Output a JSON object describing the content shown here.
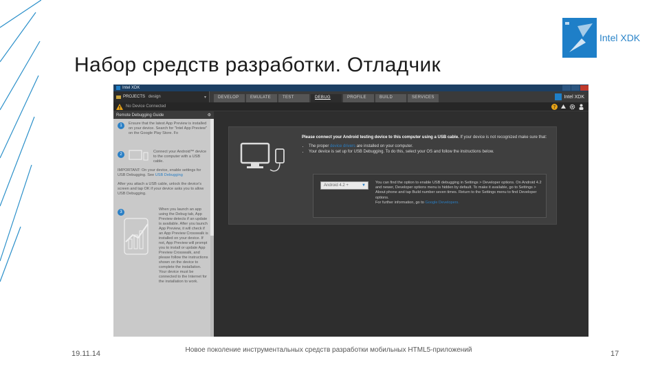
{
  "slide": {
    "title": "Набор средств разработки. Отладчик",
    "logo_text": "Intel XDK",
    "footer_date": "19.11.14",
    "footer_center": "Новое поколение инструментальных средств разработки мобильных HTML5-приложений",
    "page_number": "17"
  },
  "app": {
    "window_title": "Intel XDK",
    "brand": "Intel XDK",
    "projects_label": "PROJECTS",
    "project_value": "design",
    "tabs": [
      {
        "label": "DEVELOP",
        "active": false
      },
      {
        "label": "EMULATE",
        "active": false
      },
      {
        "label": "TEST",
        "active": false
      },
      {
        "label": "DEBUG",
        "active": true
      },
      {
        "label": "PROFILE",
        "active": false
      },
      {
        "label": "BUILD",
        "active": false
      },
      {
        "label": "SERVICES",
        "active": false
      }
    ],
    "status": "No Device Connected",
    "sidebar": {
      "header": "Remote Debugging Guide",
      "step1": "Ensure that the latest App Preview is installed on your device. Search for \"Intel App Preview\" on the Google Play Store. Fo",
      "step2a": "Connect your Android™ device to the computer with a USB cable.",
      "step2b": "IMPORTANT: On your device, enable settings for USB Debugging. See",
      "step2b_link": "USB Debugging",
      "step2c": "After you attach a USB cable, unlock the device's screen and tap OK if your device asks you to allow USB Debugging.",
      "step3": "When you launch an app using the Debug tab, App Preview detects if an update is available. After you launch App Preview, it will check if an App Preview Crosswalk is installed on your device. If not, App Preview will prompt you to install or update App Preview Crosswalk, and please follow the instructions shown on the device to complete the installation. Your device must be connected to the Internet for the installation to work."
    },
    "panel": {
      "heading": "Please connect your Android testing device to this computer using a USB cable.",
      "heading_rest": "If your device is not recognized make sure that:",
      "bullet1_pre": "The proper",
      "bullet1_link": "device drivers",
      "bullet1_post": "are installed on your computer.",
      "bullet2": "Your device is set up for USB Debugging. To do this, select your OS and follow the instructions below.",
      "select_value": "Android 4.2 +",
      "inner_text": "You can find the option to enable USB debugging in Settings > Developer options. On Android 4.2 and newer, Developer options menu is hidden by default. To make it available, go to Settings > About phone and tap Build number seven times. Return to the Settings menu to find Developer options.",
      "further_pre": "For further information, go to",
      "further_link": "Google Developers."
    }
  },
  "colors": {
    "accent": "#2a7fc5",
    "logo_blue": "#1e7fc8",
    "titlebar": "#1c3f63",
    "app_dark": "#2d2d2d"
  }
}
